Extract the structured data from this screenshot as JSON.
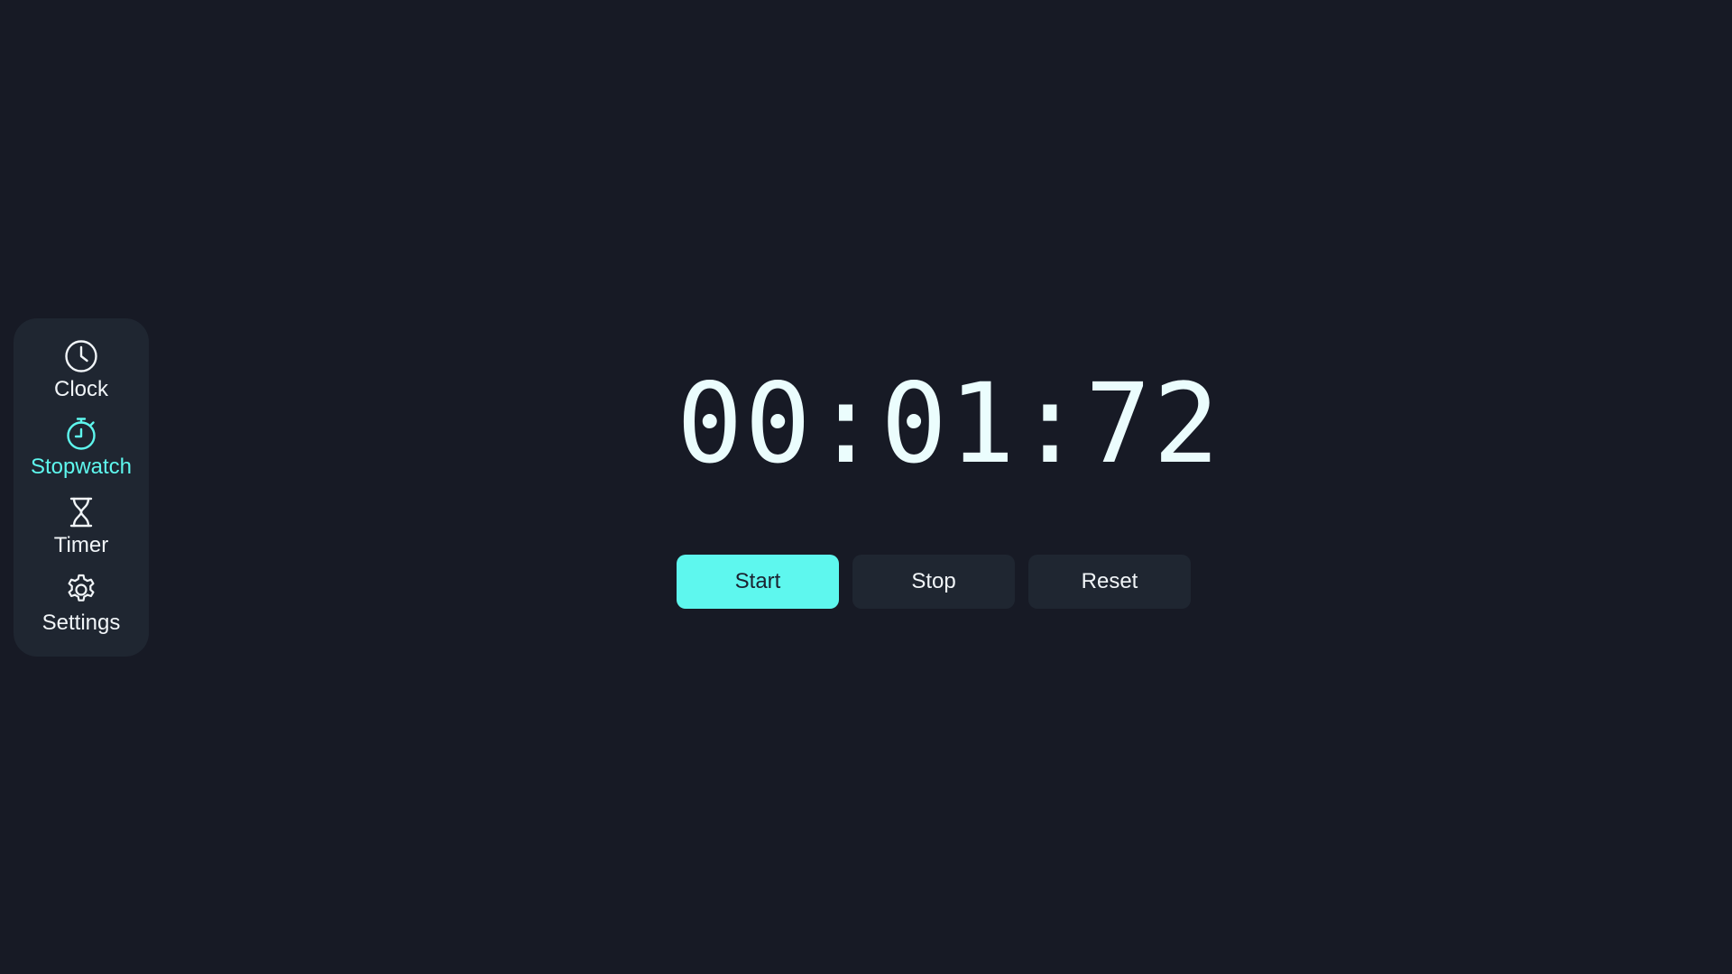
{
  "colors": {
    "background": "#171a25",
    "sidebar_bg": "#1f2631",
    "accent": "#5ef7ee",
    "text": "#f1f5f8",
    "button_bg": "#1f2631"
  },
  "sidebar": {
    "items": [
      {
        "label": "Clock",
        "icon": "clock-icon",
        "active": false
      },
      {
        "label": "Stopwatch",
        "icon": "stopwatch-icon",
        "active": true
      },
      {
        "label": "Timer",
        "icon": "hourglass-icon",
        "active": false
      },
      {
        "label": "Settings",
        "icon": "gear-icon",
        "active": false
      }
    ]
  },
  "stopwatch": {
    "display": "00:01:72"
  },
  "controls": {
    "start_label": "Start",
    "stop_label": "Stop",
    "reset_label": "Reset"
  }
}
